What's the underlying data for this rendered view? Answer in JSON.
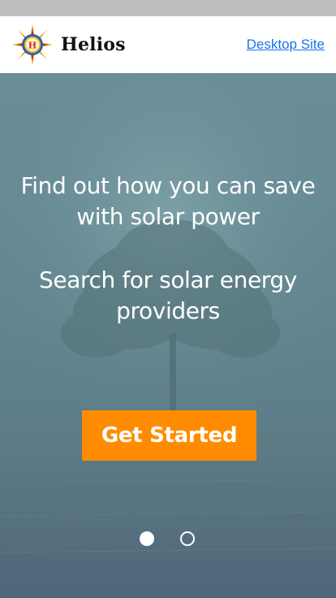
{
  "header": {
    "brand_name": "Helios",
    "logo_letter": "H",
    "desktop_link": "Desktop Site"
  },
  "hero": {
    "headline": "Find out how you can save with solar power",
    "subline": "Search for solar energy providers",
    "cta_label": "Get Started",
    "slides": [
      {
        "label": "slide-1",
        "active": true
      },
      {
        "label": "slide-2",
        "active": false
      }
    ]
  },
  "colors": {
    "accent": "#ff8c00",
    "link": "#1a73e8",
    "hero_overlay": "#62858f",
    "status_strip": "#bdbdbd"
  },
  "icons": {
    "logo": "sun-compass-icon"
  }
}
